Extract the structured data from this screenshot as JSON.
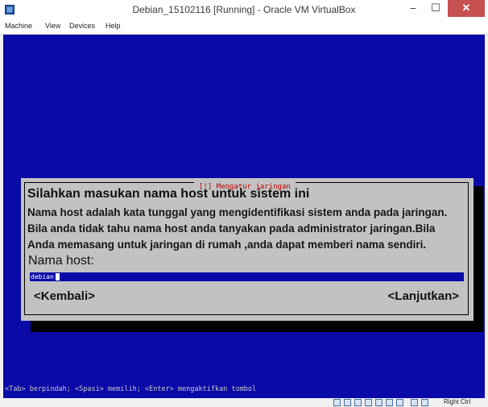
{
  "window": {
    "title": "Debian_15102116 [Running] - Oracle VM VirtualBox",
    "minimize_glyph": "–",
    "maximize_glyph": "☐",
    "close_glyph": "✕",
    "close_color": "#c75050"
  },
  "menu": {
    "items": [
      "Machine",
      "View",
      "Devices",
      "Help"
    ]
  },
  "screen": {
    "background_color": "#0a0aa8"
  },
  "dialog": {
    "title": "[!] Mengatur jaringan",
    "heading": "Silahkan masukan nama host untuk sistem ini",
    "lines": [
      "Nama host adalah kata tunggal yang mengidentifikasi sistem anda pada jaringan.",
      "Bila anda tidak tahu nama host anda tanyakan pada administrator jaringan.Bila",
      "Anda memasang untuk jaringan di rumah ,anda dapat memberi nama sendiri."
    ],
    "field_label": "Nama host:",
    "hostname_value": "debian",
    "back_button": "<Kembali>",
    "next_button": "<Lanjutkan>"
  },
  "help_line": "<Tab> berpindah; <Spasi> memilih; <Enter> mengaktifkan tombol",
  "statusbar": {
    "icons": [
      "hard-disk-icon",
      "optical-drive-icon",
      "usb-icon",
      "network-icon",
      "shared-folders-icon",
      "display-icon",
      "video-capture-icon",
      "mouse-integration-icon",
      "host-key-icon"
    ],
    "host_key": "Right Ctrl"
  }
}
